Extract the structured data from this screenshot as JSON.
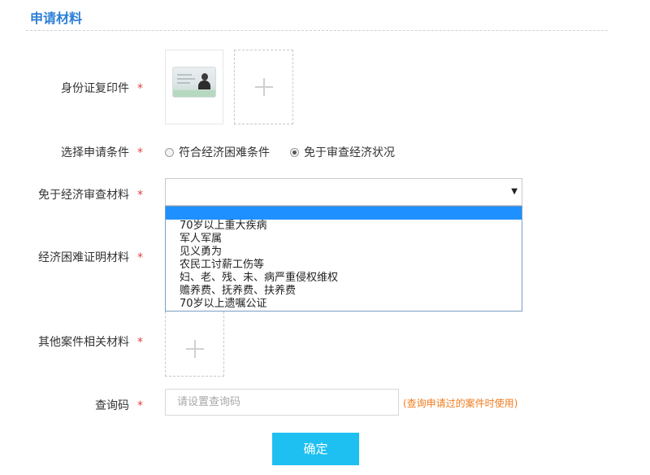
{
  "section": {
    "title": "申请材料"
  },
  "required_mark": "*",
  "fields": {
    "id_copy": {
      "label": "身份证复印件"
    },
    "condition": {
      "label": "选择申请条件",
      "options": [
        "符合经济困难条件",
        "免于审查经济状况"
      ],
      "selected": 1
    },
    "exempt_material": {
      "label": "免于经济审查材料",
      "selected_value": "",
      "options": [
        "",
        "70岁以上重大疾病",
        "军人军属",
        "见义勇为",
        "农民工讨薪工伤等",
        "妇、老、残、未、病严重侵权维权",
        "赡养费、抚养费、扶养费",
        "70岁以上遗嘱公证"
      ]
    },
    "hardship_proof": {
      "label": "经济困难证明材料"
    },
    "other_materials": {
      "label": "其他案件相关材料"
    },
    "query_code": {
      "label": "查询码",
      "placeholder": "请设置查询码",
      "value": "",
      "hint": "(查询申请过的案件时使用)"
    }
  },
  "submit_label": "确定",
  "colors": {
    "accent": "#2b7fd6",
    "required": "#e04040",
    "button": "#1ec0f2",
    "hint": "#f07b1e",
    "highlight": "#1e90ff"
  },
  "icons": [
    "plus-icon",
    "caret-down-icon",
    "radio-icon",
    "id-card-thumbnail"
  ]
}
